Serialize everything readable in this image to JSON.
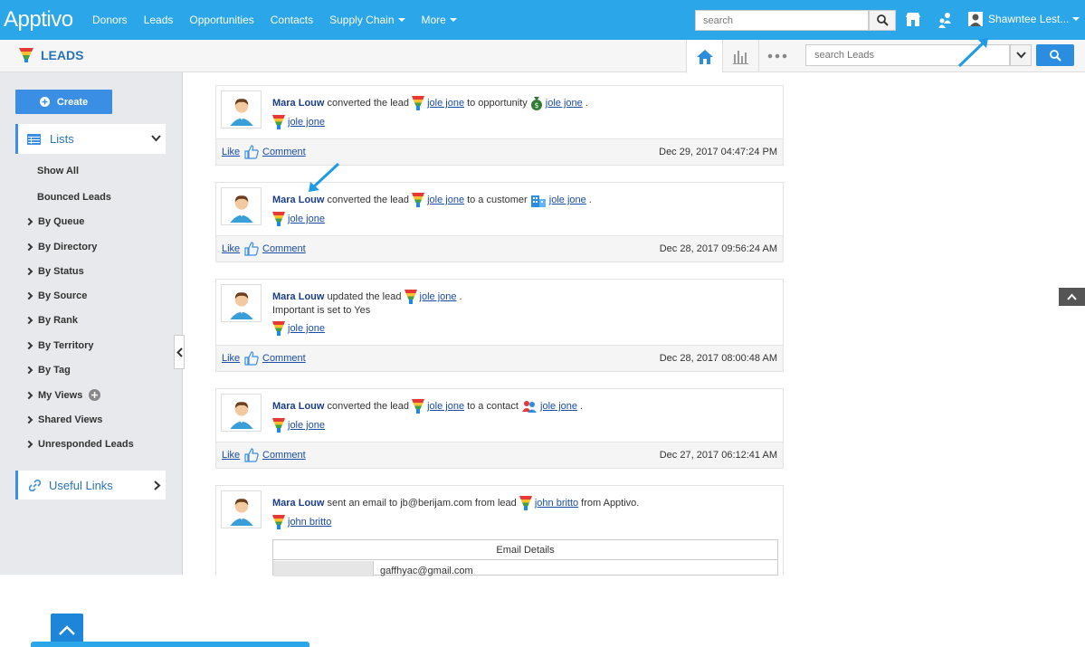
{
  "app": {
    "logo": "Apptivo"
  },
  "nav": {
    "items": [
      {
        "label": "Donors"
      },
      {
        "label": "Leads"
      },
      {
        "label": "Opportunities"
      },
      {
        "label": "Contacts"
      },
      {
        "label": "Supply Chain",
        "dropdown": true
      },
      {
        "label": "More",
        "dropdown": true
      }
    ],
    "search_placeholder": "search",
    "user_name": "Shawntee Lest..."
  },
  "header": {
    "title": "LEADS",
    "search_placeholder": "search Leads"
  },
  "sidebar": {
    "create_label": "Create",
    "lists_label": "Lists",
    "items": [
      {
        "label": "Show All"
      },
      {
        "label": "Bounced Leads"
      },
      {
        "label": "By Queue"
      },
      {
        "label": "By Directory"
      },
      {
        "label": "By Status"
      },
      {
        "label": "By Source"
      },
      {
        "label": "By Rank"
      },
      {
        "label": "By Territory"
      },
      {
        "label": "By Tag"
      },
      {
        "label": "My Views"
      },
      {
        "label": "Shared Views"
      },
      {
        "label": "Unresponded Leads"
      }
    ],
    "useful_links_label": "Useful Links"
  },
  "feed": {
    "like_label": "Like",
    "comment_label": "Comment",
    "items": [
      {
        "user": "Mara Louw",
        "action": "converted the lead",
        "lead": "jole jone",
        "mid": "to opportunity",
        "target": "jole jone",
        "end": ".",
        "sub": "jole jone",
        "date": "Dec 29, 2017 04:47:24 PM"
      },
      {
        "user": "Mara Louw",
        "action": "converted the lead",
        "lead": "jole jone",
        "mid": "to a customer",
        "target": "jole jone",
        "end": ".",
        "sub": "jole jone",
        "date": "Dec 28, 2017 09:56:24 AM"
      },
      {
        "user": "Mara Louw",
        "action": "updated the lead",
        "lead": "jole jone",
        "end": ".",
        "note": "Important is set to Yes",
        "sub": "jole jone",
        "date": "Dec 28, 2017 08:00:48 AM"
      },
      {
        "user": "Mara Louw",
        "action": "converted the lead",
        "lead": "jole jone",
        "mid": "to a contact",
        "target": "jole jone",
        "end": ".",
        "sub": "jole jone",
        "date": "Dec 27, 2017 06:12:41 AM"
      },
      {
        "user": "Mara Louw",
        "action": "sent an email to jb@berijam.com from lead",
        "lead": "john britto",
        "mid": "from Apptivo.",
        "sub": "john britto"
      }
    ],
    "email_details_title": "Email Details",
    "email_value": "gaffhyac@gmail.com"
  },
  "colors": {
    "topbar": "#2aa6e9",
    "accent": "#3a8fe4",
    "link": "#1a4ca8"
  }
}
